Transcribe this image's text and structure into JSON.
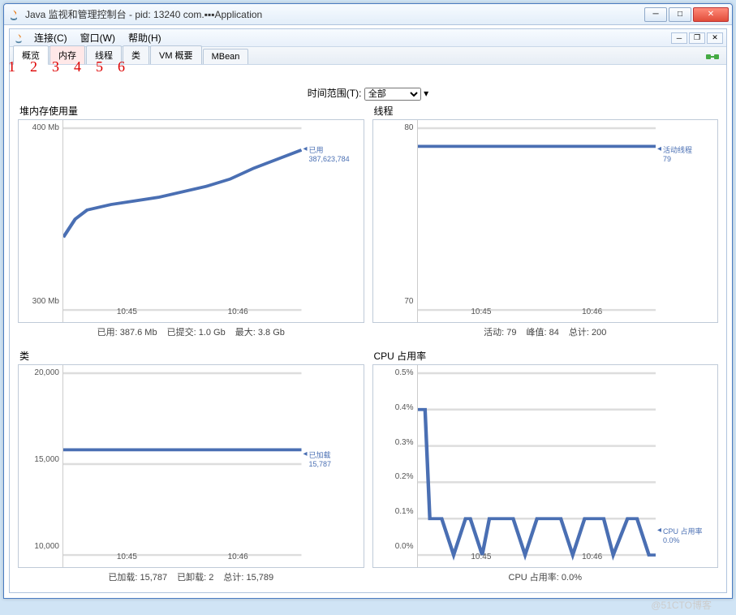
{
  "window": {
    "title": "Java 监视和管理控制台 - pid: 13240 com.▪▪▪Application"
  },
  "menus": {
    "connect": "连接(C)",
    "window": "窗口(W)",
    "help": "帮助(H)"
  },
  "tabs": [
    "概览",
    "内存",
    "线程",
    "类",
    "VM 概要",
    "MBean"
  ],
  "annotations": [
    "1",
    "2",
    "3",
    "4",
    "5",
    "6"
  ],
  "time_range": {
    "label": "时间范围(T):",
    "value": "全部"
  },
  "chart_data": [
    {
      "id": "heap",
      "title": "堆内存使用量",
      "type": "line",
      "y_ticks": [
        "400 Mb",
        "300 Mb"
      ],
      "x_ticks": [
        "10:45",
        "10:46"
      ],
      "legend": {
        "label": "已用",
        "value": "387,623,784"
      },
      "series": [
        {
          "name": "已用",
          "x": [
            0,
            5,
            10,
            20,
            30,
            40,
            50,
            60,
            70,
            80,
            90,
            100
          ],
          "y": [
            340,
            350,
            355,
            358,
            360,
            362,
            365,
            368,
            372,
            378,
            383,
            388
          ]
        }
      ],
      "ylim": [
        300,
        400
      ],
      "stats": {
        "used_label": "已用:",
        "used": "387.6 Mb",
        "commit_label": "已提交:",
        "commit": "1.0 Gb",
        "max_label": "最大:",
        "max": "3.8 Gb"
      }
    },
    {
      "id": "threads",
      "title": "线程",
      "type": "line",
      "y_ticks": [
        "80",
        "70"
      ],
      "x_ticks": [
        "10:45",
        "10:46"
      ],
      "legend": {
        "label": "活动线程",
        "value": "79"
      },
      "series": [
        {
          "name": "活动线程",
          "x": [
            0,
            100
          ],
          "y": [
            79,
            79
          ]
        }
      ],
      "ylim": [
        70,
        80
      ],
      "stats": {
        "live_label": "活动:",
        "live": "79",
        "peak_label": "峰值:",
        "peak": "84",
        "total_label": "总计:",
        "total": "200"
      }
    },
    {
      "id": "classes",
      "title": "类",
      "type": "line",
      "y_ticks": [
        "20,000",
        "15,000",
        "10,000"
      ],
      "x_ticks": [
        "10:45",
        "10:46"
      ],
      "legend": {
        "label": "已加载",
        "value": "15,787"
      },
      "series": [
        {
          "name": "已加载",
          "x": [
            0,
            100
          ],
          "y": [
            15787,
            15787
          ]
        }
      ],
      "ylim": [
        10000,
        20000
      ],
      "stats": {
        "loaded_label": "已加载:",
        "loaded": "15,787",
        "unloaded_label": "已卸载:",
        "unloaded": "2",
        "total_label": "总计:",
        "total": "15,789"
      }
    },
    {
      "id": "cpu",
      "title": "CPU 占用率",
      "type": "line",
      "y_ticks": [
        "0.5%",
        "0.4%",
        "0.3%",
        "0.2%",
        "0.1%",
        "0.0%"
      ],
      "x_ticks": [
        "10:45",
        "10:46"
      ],
      "legend": {
        "label": "CPU 占用率",
        "value": "0.0%"
      },
      "series": [
        {
          "name": "CPU 占用率",
          "x": [
            0,
            3,
            5,
            10,
            15,
            20,
            22,
            27,
            30,
            35,
            40,
            45,
            50,
            55,
            60,
            65,
            70,
            73,
            78,
            82,
            88,
            92,
            97,
            100
          ],
          "y": [
            0.4,
            0.4,
            0.1,
            0.1,
            0.0,
            0.1,
            0.1,
            0.0,
            0.1,
            0.1,
            0.1,
            0.0,
            0.1,
            0.1,
            0.1,
            0.0,
            0.1,
            0.1,
            0.1,
            0.0,
            0.1,
            0.1,
            0.0,
            0.0
          ]
        }
      ],
      "ylim": [
        0,
        0.5
      ],
      "stats": {
        "cpu_label": "CPU 占用率:",
        "cpu": "0.0%"
      }
    }
  ],
  "watermark": "@51CTO博客"
}
